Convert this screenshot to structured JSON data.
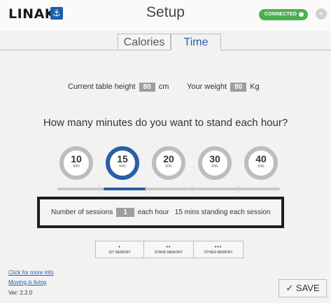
{
  "header": {
    "logo": "LINAK",
    "logo_mark": "⚓",
    "title": "Setup",
    "connection_status": "CONNECTED",
    "connection_icon": "✓",
    "close_icon": "×"
  },
  "tabs": [
    {
      "label": "Calories",
      "active": false
    },
    {
      "label": "Time",
      "active": true
    }
  ],
  "info": {
    "table_height_label": "Current table height",
    "table_height_value": "80",
    "table_height_unit": "cm",
    "weight_label": "Your weight",
    "weight_value": "80",
    "weight_unit": "Kg"
  },
  "question": "How many minutes do you want to stand each hour?",
  "minute_options": [
    {
      "value": "10",
      "unit": "MIN"
    },
    {
      "value": "15",
      "unit": "MIN"
    },
    {
      "value": "20",
      "unit": "MIN"
    },
    {
      "value": "30",
      "unit": "MIN"
    },
    {
      "value": "40",
      "unit": "MIN"
    }
  ],
  "selected_minutes": "15",
  "sessions": {
    "label": "Number of sessions",
    "value": "1",
    "suffix": "each hour",
    "summary": "15 mins standing each session"
  },
  "memory_buttons": [
    {
      "dots": "•",
      "label": "SIT MEMORY"
    },
    {
      "dots": "••",
      "label": "STAND MEMORY"
    },
    {
      "dots": "•••",
      "label": "OTHER MEMORY"
    }
  ],
  "footer": {
    "more_info": "Click for more info",
    "moving": "Moving is living",
    "version": "Ver: 2.2.0",
    "save_icon": "✓",
    "save_label": "SAVE"
  },
  "colors": {
    "accent": "#2b5ea8",
    "connected": "#4caf50",
    "background": "#f2f2f2"
  }
}
